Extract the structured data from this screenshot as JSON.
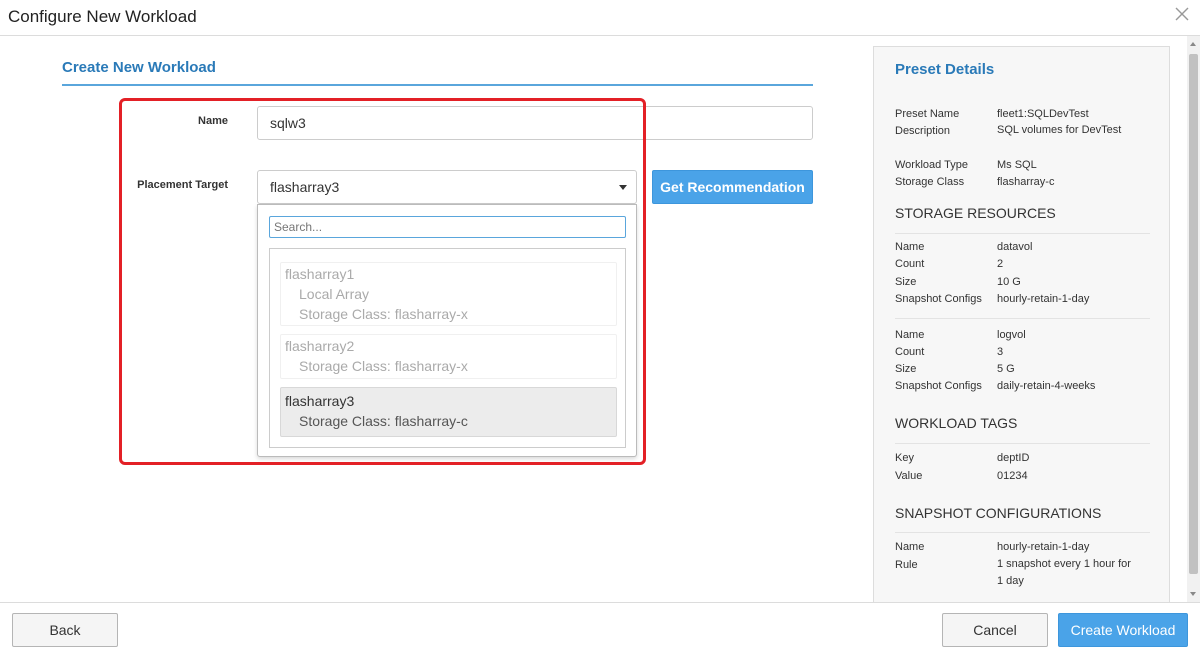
{
  "dialog": {
    "title": "Configure New Workload",
    "close_icon": "close-icon"
  },
  "form": {
    "section_title": "Create New Workload",
    "name_label": "Name",
    "name_value": "sqlw3",
    "placement_label": "Placement Target",
    "placement_value": "flasharray3",
    "recommend_label": "Get Recommendation",
    "search_placeholder": "Search...",
    "options": [
      {
        "name": "flasharray1",
        "lines": [
          "Local Array",
          "Storage Class: flasharray-x"
        ],
        "selected": false
      },
      {
        "name": "flasharray2",
        "lines": [
          "Storage Class: flasharray-x"
        ],
        "selected": false
      },
      {
        "name": "flasharray3",
        "lines": [
          "Storage Class: flasharray-c"
        ],
        "selected": true
      }
    ],
    "highlight_color": "#e32026"
  },
  "preset": {
    "title": "Preset Details",
    "preset_name_key": "Preset Name",
    "preset_name": "fleet1:SQLDevTest",
    "description_key": "Description",
    "description": "SQL volumes for DevTest",
    "workload_type_key": "Workload Type",
    "workload_type": "Ms SQL",
    "storage_class_key": "Storage Class",
    "storage_class": "flasharray-c",
    "storage_heading": "STORAGE RESOURCES",
    "volumes": [
      {
        "name_key": "Name",
        "name": "datavol",
        "count_key": "Count",
        "count": "2",
        "size_key": "Size",
        "size": "10 G",
        "snap_key": "Snapshot Configs",
        "snap": "hourly-retain-1-day"
      },
      {
        "name_key": "Name",
        "name": "logvol",
        "count_key": "Count",
        "count": "3",
        "size_key": "Size",
        "size": "5 G",
        "snap_key": "Snapshot Configs",
        "snap": "daily-retain-4-weeks"
      }
    ],
    "tags_heading": "WORKLOAD TAGS",
    "tag_key_label": "Key",
    "tag_key": "deptID",
    "tag_value_label": "Value",
    "tag_value": "01234",
    "snap_heading": "SNAPSHOT CONFIGURATIONS",
    "snap_name_key": "Name",
    "snap_name": "hourly-retain-1-day",
    "snap_rule_key": "Rule",
    "snap_rule": "1 snapshot every 1 hour for 1 day"
  },
  "footer": {
    "back_label": "Back",
    "cancel_label": "Cancel",
    "create_label": "Create Workload"
  },
  "colors": {
    "accent": "#2a7ab8",
    "primary_button": "#4aa3e8"
  }
}
